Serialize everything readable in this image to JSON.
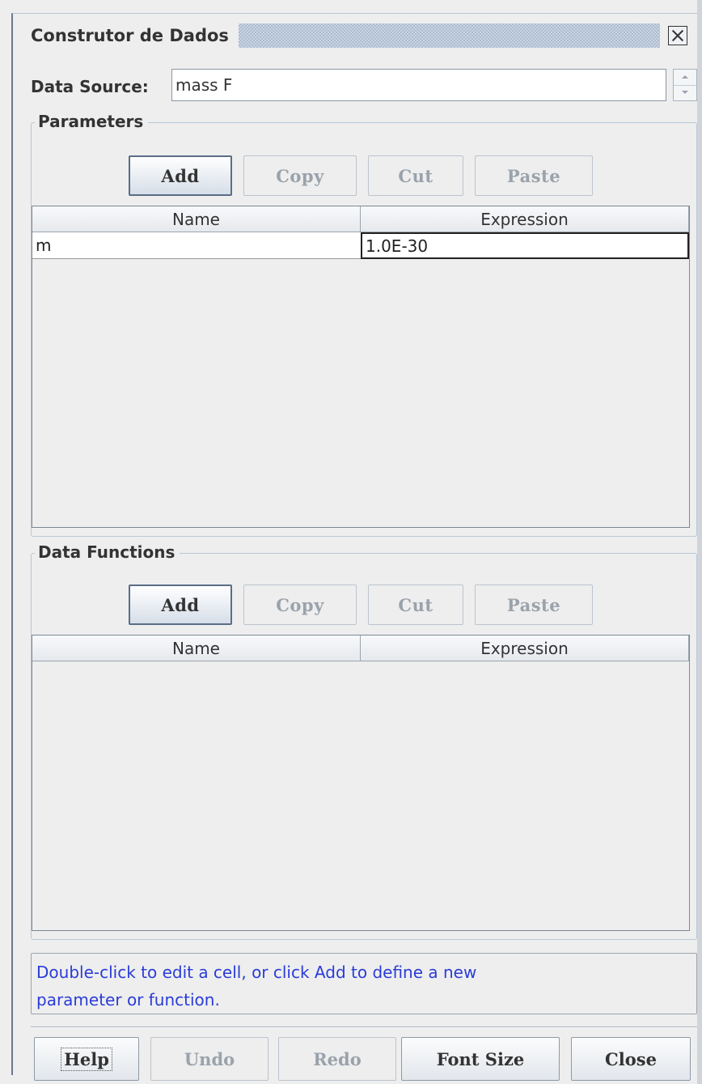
{
  "window": {
    "title": "Construtor de Dados"
  },
  "data_source": {
    "label": "Data Source:",
    "value": "mass F"
  },
  "parameters": {
    "title": "Parameters",
    "buttons": {
      "add": "Add",
      "copy": "Copy",
      "cut": "Cut",
      "paste": "Paste"
    },
    "columns": {
      "name": "Name",
      "expression": "Expression"
    },
    "rows": [
      {
        "name": "m",
        "expression": "1.0E-30"
      }
    ]
  },
  "data_functions": {
    "title": "Data Functions",
    "buttons": {
      "add": "Add",
      "copy": "Copy",
      "cut": "Cut",
      "paste": "Paste"
    },
    "columns": {
      "name": "Name",
      "expression": "Expression"
    }
  },
  "hint": {
    "line1": "Double-click to edit a cell, or click Add to define a new",
    "line2": "parameter or function."
  },
  "footer": {
    "help": "Help",
    "undo": "Undo",
    "redo": "Redo",
    "font_size": "Font Size",
    "close": "Close"
  }
}
